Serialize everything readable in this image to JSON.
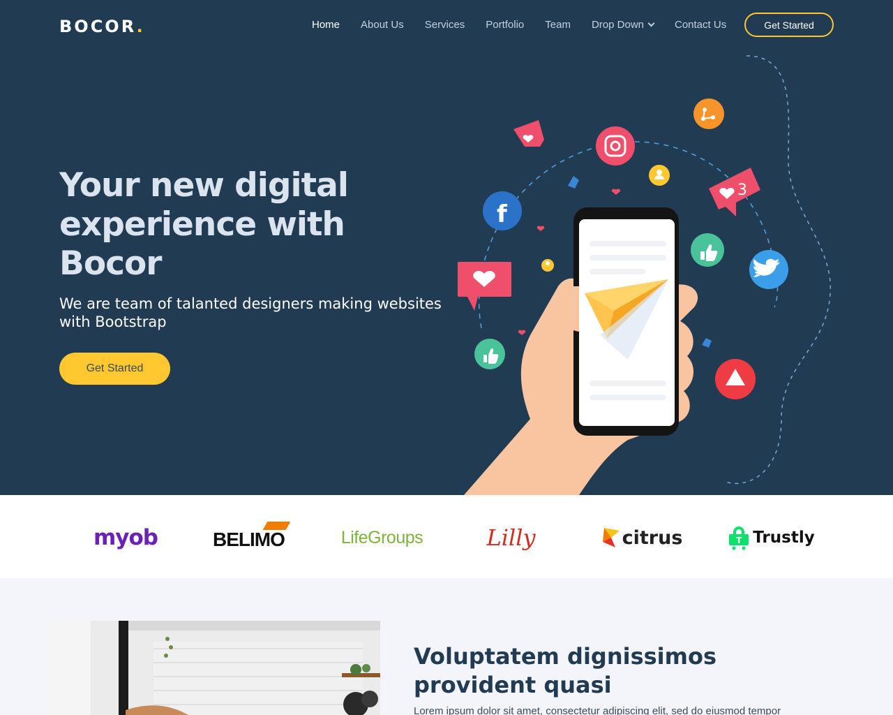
{
  "header": {
    "logo_text": "BOCOR",
    "logo_dot": ".",
    "nav": [
      {
        "label": "Home"
      },
      {
        "label": "About Us"
      },
      {
        "label": "Services"
      },
      {
        "label": "Portfolio"
      },
      {
        "label": "Team"
      },
      {
        "label": "Drop Down"
      },
      {
        "label": "Contact Us"
      }
    ],
    "cta_label": "Get Started"
  },
  "hero": {
    "title": "Your new digital experience with Bocor",
    "subtitle": "We are team of talanted designers making websites with Bootstrap",
    "cta_label": "Get Started",
    "notification_count": "3"
  },
  "clients": [
    {
      "name": "myob"
    },
    {
      "name": "BELIMO"
    },
    {
      "name": "LifeGroups"
    },
    {
      "name": "Lilly"
    },
    {
      "name": "citrus"
    },
    {
      "name": "Trustly"
    }
  ],
  "about": {
    "title": "Voluptatem dignissimos provident quasi",
    "text": "Lorem ipsum dolor sit amet, consectetur adipiscing elit, sed do eiusmod tempor"
  },
  "colors": {
    "primary": "#213b52",
    "accent": "#ffc830",
    "section_bg": "#f3f5fa"
  }
}
